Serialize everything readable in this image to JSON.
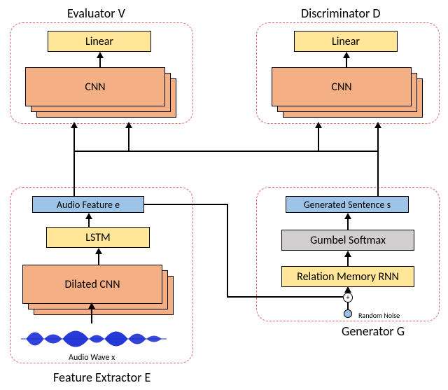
{
  "chart_data": {
    "type": "diagram",
    "modules": [
      {
        "name": "Evaluator V",
        "layers": [
          "CNN (stacked)",
          "Linear"
        ],
        "inputs": [
          "Audio Feature e",
          "Generated Sentence s"
        ]
      },
      {
        "name": "Discriminator D",
        "layers": [
          "CNN (stacked)",
          "Linear"
        ],
        "inputs": [
          "Audio Feature e",
          "Generated Sentence s"
        ]
      },
      {
        "name": "Feature Extractor E",
        "layers": [
          "Audio Wave x",
          "Dilated CNN (stacked)",
          "LSTM",
          "Audio Feature e"
        ]
      },
      {
        "name": "Generator G",
        "layers": [
          "Random Noise + Audio Feature e (⊕)",
          "Relation Memory RNN",
          "Gumbel Softmax",
          "Generated Sentence s"
        ]
      }
    ],
    "edges": [
      [
        "Audio Wave x",
        "Dilated CNN"
      ],
      [
        "Dilated CNN",
        "LSTM"
      ],
      [
        "LSTM",
        "Audio Feature e"
      ],
      [
        "Audio Feature e",
        "Evaluator V.CNN"
      ],
      [
        "Audio Feature e",
        "Discriminator D.CNN"
      ],
      [
        "Audio Feature e",
        "Generator G.⊕"
      ],
      [
        "Random Noise",
        "Generator G.⊕"
      ],
      [
        "Generator G.⊕",
        "Relation Memory RNN"
      ],
      [
        "Relation Memory RNN",
        "Gumbel Softmax"
      ],
      [
        "Gumbel Softmax",
        "Generated Sentence s"
      ],
      [
        "Generated Sentence s",
        "Evaluator V.CNN"
      ],
      [
        "Generated Sentence s",
        "Discriminator D.CNN"
      ],
      [
        "Evaluator V.CNN",
        "Evaluator V.Linear"
      ],
      [
        "Discriminator D.CNN",
        "Discriminator D.Linear"
      ]
    ]
  },
  "evaluator": {
    "title": "Evaluator V",
    "linear": "Linear",
    "cnn": "CNN"
  },
  "discriminator": {
    "title": "Discriminator D",
    "linear": "Linear",
    "cnn": "CNN"
  },
  "extractor": {
    "title": "Feature Extractor E",
    "audio_feature": "Audio Feature e",
    "lstm": "LSTM",
    "dilated_cnn": "Dilated CNN",
    "audio_wave_label": "Audio Wave x"
  },
  "generator": {
    "title": "Generator G",
    "generated_sentence": "Generated Sentence s",
    "gumbel_softmax": "Gumbel Softmax",
    "relation_memory_rnn": "Relation Memory RNN",
    "random_noise_label": "Random Noise"
  }
}
